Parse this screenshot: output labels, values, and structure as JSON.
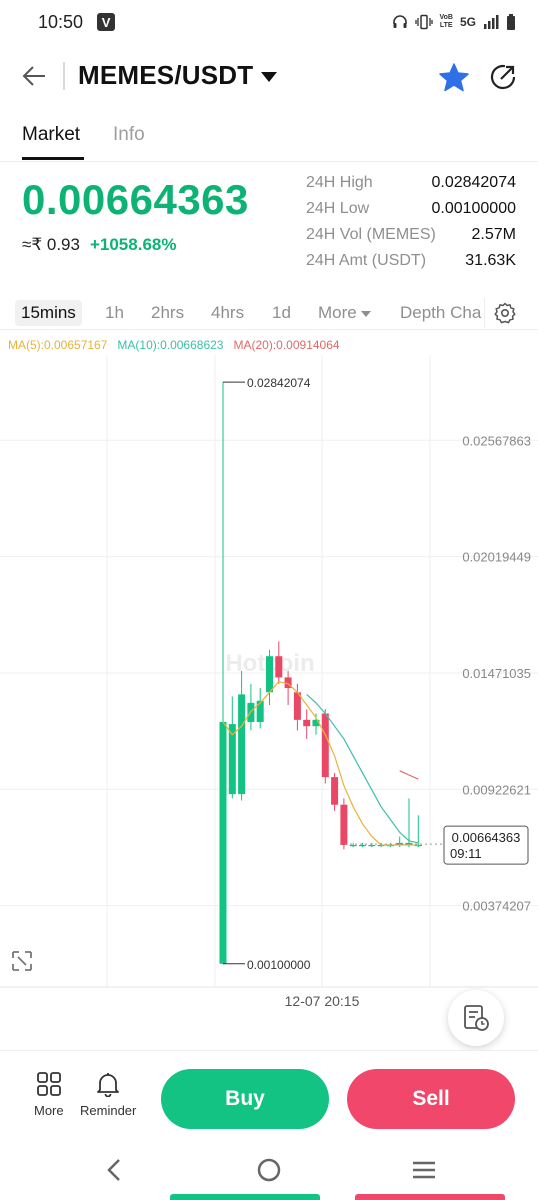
{
  "status": {
    "time": "10:50",
    "network": "5G",
    "lte_top": "VoB",
    "lte_bottom": "LTE"
  },
  "header": {
    "pair": "MEMES/USDT"
  },
  "tabs": [
    {
      "label": "Market",
      "active": true
    },
    {
      "label": "Info",
      "active": false
    }
  ],
  "ticker": {
    "last_price": "0.00664363",
    "fiat": "≈₹ 0.93",
    "change": "+1058.68%",
    "stats": [
      {
        "label": "24H High",
        "value": "0.02842074"
      },
      {
        "label": "24H Low",
        "value": "0.00100000"
      },
      {
        "label": "24H Vol (MEMES)",
        "value": "2.57M"
      },
      {
        "label": "24H Amt (USDT)",
        "value": "31.63K"
      }
    ]
  },
  "intervals": [
    {
      "label": "15mins",
      "active": true
    },
    {
      "label": "1h",
      "active": false
    },
    {
      "label": "2hrs",
      "active": false
    },
    {
      "label": "4hrs",
      "active": false
    },
    {
      "label": "1d",
      "active": false
    },
    {
      "label": "More",
      "active": false
    },
    {
      "label": "Depth Cha",
      "active": false
    }
  ],
  "ma": {
    "ma5": "MA(5):0.00657167",
    "ma10": "MA(10):0.00668623",
    "ma20": "MA(20):0.00914064"
  },
  "chart_data": {
    "type": "candlestick",
    "y_axis_labels": [
      "0.02567863",
      "0.02019449",
      "0.01471035",
      "0.00922621",
      "0.00374207"
    ],
    "ylim": [
      0.0,
      0.0297
    ],
    "x_axis_label": "12-07 20:15",
    "high_label": "0.02842074",
    "low_label": "0.00100000",
    "current_price_label": "0.00664363",
    "countdown": "09:11",
    "watermark": "Hotcoin",
    "candles": [
      {
        "o": 0.001,
        "c": 0.0124,
        "h": 0.02842074,
        "l": 0.001
      },
      {
        "o": 0.009,
        "c": 0.0123,
        "h": 0.0136,
        "l": 0.0088
      },
      {
        "o": 0.009,
        "c": 0.0137,
        "h": 0.0148,
        "l": 0.0087
      },
      {
        "o": 0.0124,
        "c": 0.0133,
        "h": 0.0142,
        "l": 0.012
      },
      {
        "o": 0.0124,
        "c": 0.0134,
        "h": 0.014,
        "l": 0.0121
      },
      {
        "o": 0.0138,
        "c": 0.0155,
        "h": 0.0158,
        "l": 0.0132
      },
      {
        "o": 0.0155,
        "c": 0.0145,
        "h": 0.0162,
        "l": 0.0142
      },
      {
        "o": 0.0145,
        "c": 0.014,
        "h": 0.0148,
        "l": 0.0132
      },
      {
        "o": 0.0138,
        "c": 0.0125,
        "h": 0.0142,
        "l": 0.012
      },
      {
        "o": 0.0125,
        "c": 0.0122,
        "h": 0.013,
        "l": 0.0116
      },
      {
        "o": 0.0122,
        "c": 0.0125,
        "h": 0.0128,
        "l": 0.0118
      },
      {
        "o": 0.0128,
        "c": 0.0098,
        "h": 0.013,
        "l": 0.0095
      },
      {
        "o": 0.0098,
        "c": 0.0085,
        "h": 0.01,
        "l": 0.0082
      },
      {
        "o": 0.0085,
        "c": 0.0066,
        "h": 0.0088,
        "l": 0.0064
      },
      {
        "o": 0.0066,
        "c": 0.0066,
        "h": 0.0067,
        "l": 0.0065
      },
      {
        "o": 0.0066,
        "c": 0.0066,
        "h": 0.0067,
        "l": 0.0065
      },
      {
        "o": 0.0066,
        "c": 0.0066,
        "h": 0.0067,
        "l": 0.0065
      },
      {
        "o": 0.0066,
        "c": 0.0066,
        "h": 0.0067,
        "l": 0.0065
      },
      {
        "o": 0.0066,
        "c": 0.0066,
        "h": 0.0067,
        "l": 0.0065
      },
      {
        "o": 0.0066,
        "c": 0.0067,
        "h": 0.007,
        "l": 0.0065
      },
      {
        "o": 0.0066,
        "c": 0.0067,
        "h": 0.0088,
        "l": 0.0065
      },
      {
        "o": 0.0066,
        "c": 0.0066,
        "h": 0.008,
        "l": 0.0065
      }
    ],
    "ma5": [
      0.0124,
      0.0118,
      0.0122,
      0.0129,
      0.0133,
      0.0138,
      0.0143,
      0.0142,
      0.0138,
      0.0132,
      0.0126,
      0.0118,
      0.0108,
      0.0094,
      0.0084,
      0.0076,
      0.007,
      0.0066,
      0.0066,
      0.0066,
      0.0066,
      0.0066
    ],
    "ma10": [
      null,
      null,
      null,
      null,
      null,
      null,
      null,
      null,
      null,
      0.0137,
      0.0133,
      0.0128,
      0.0122,
      0.0116,
      0.0108,
      0.01,
      0.0092,
      0.0084,
      0.0078,
      0.0072,
      0.0068,
      0.0067
    ],
    "ma20": [
      null,
      null,
      null,
      null,
      null,
      null,
      null,
      null,
      null,
      null,
      null,
      null,
      null,
      null,
      null,
      null,
      null,
      null,
      null,
      0.0101,
      0.0099,
      0.0097
    ]
  },
  "bottom": {
    "more_label": "More",
    "reminder_label": "Reminder",
    "buy_label": "Buy",
    "sell_label": "Sell"
  },
  "colors": {
    "up": "#12c383",
    "down": "#e84865",
    "ma5": "#e8b33a",
    "ma10": "#3cbfa8",
    "ma20": "#e06a6a",
    "accent": "#2f6fe8"
  }
}
